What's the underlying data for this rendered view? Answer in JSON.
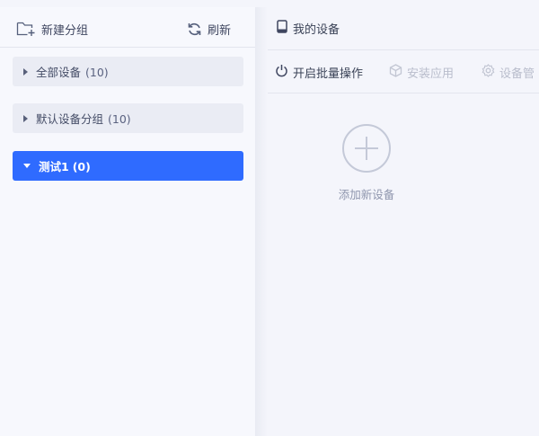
{
  "left_toolbar": {
    "new_group_label": "新建分组",
    "refresh_label": "刷新"
  },
  "groups": [
    {
      "label": "全部设备",
      "count": "(10)",
      "expanded": false,
      "selected": false
    },
    {
      "label": "默认设备分组",
      "count": "(10)",
      "expanded": false,
      "selected": false
    },
    {
      "label": "测试1",
      "count": "(0)",
      "expanded": true,
      "selected": true
    }
  ],
  "right_header": {
    "title": "我的设备"
  },
  "actions": {
    "batch_label": "开启批量操作",
    "install_label": "安装应用",
    "manage_label": "设备管"
  },
  "empty_state": {
    "add_label": "添加新设备"
  },
  "colors": {
    "accent": "#2f6bff",
    "disabled_text": "#b9bdcc"
  },
  "icons": {
    "new_group": "folder-plus-icon",
    "refresh": "refresh-icon",
    "device": "phone-icon",
    "batch": "power-icon",
    "install": "cube-icon",
    "manage": "gear-icon",
    "add": "plus-circle-icon"
  }
}
